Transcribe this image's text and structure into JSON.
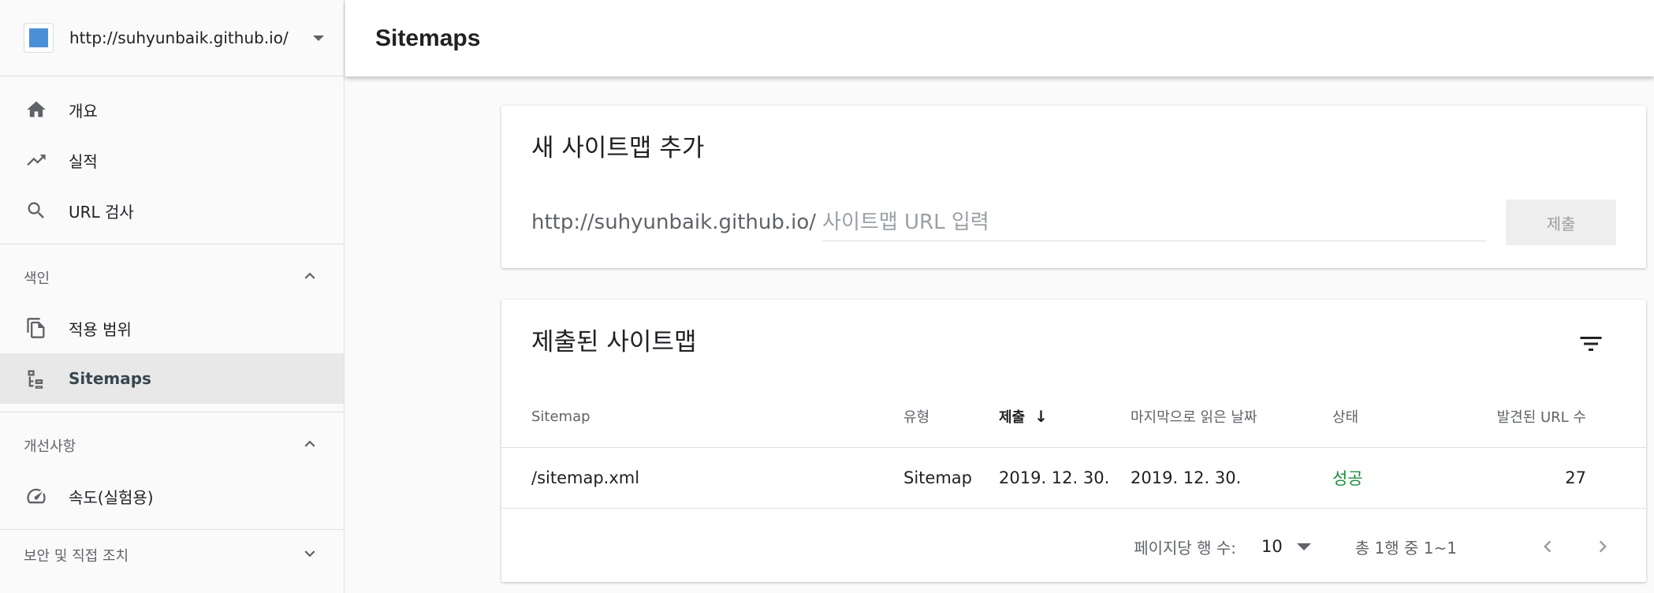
{
  "property": {
    "url": "http://suhyunbaik.github.io/",
    "icon": "blue-square-icon"
  },
  "sidebar": {
    "main_items": [
      {
        "label": "개요",
        "icon": "home-icon"
      },
      {
        "label": "실적",
        "icon": "trending-up-icon"
      },
      {
        "label": "URL 검사",
        "icon": "search-icon"
      }
    ],
    "index_section": {
      "title": "색인",
      "icon": "chevron-up-icon"
    },
    "index_items": [
      {
        "label": "적용 범위",
        "icon": "copy-pages-icon"
      },
      {
        "label": "Sitemaps",
        "icon": "sitemap-icon",
        "active": true
      }
    ],
    "enhance_section": {
      "title": "개선사항",
      "icon": "chevron-up-icon"
    },
    "enhance_items": [
      {
        "label": "속도(실험용)",
        "icon": "speedometer-icon"
      }
    ],
    "security_section": {
      "title": "보안 및 직접 조치",
      "icon": "chevron-down-icon"
    }
  },
  "header": {
    "title": "Sitemaps"
  },
  "add_card": {
    "title": "새 사이트맵 추가",
    "url_prefix": "http://suhyunbaik.github.io/",
    "placeholder": "사이트맵 URL 입력",
    "submit_label": "제출"
  },
  "submitted_card": {
    "title": "제출된 사이트맵",
    "columns": [
      "Sitemap",
      "유형",
      "제출",
      "마지막으로 읽은 날짜",
      "상태",
      "발견된 URL 수"
    ],
    "sort_arrow": "↓",
    "rows": [
      {
        "sitemap": "/sitemap.xml",
        "type": "Sitemap",
        "submitted": "2019. 12. 30.",
        "last_read": "2019. 12. 30.",
        "status": "성공",
        "urls": "27"
      }
    ],
    "pager": {
      "rows_label": "페이지당 행 수:",
      "rows_value": "10",
      "range": "총 1행 중 1~1"
    }
  },
  "colors": {
    "success": "#1e8e3e",
    "active_bg": "#e8e8e8",
    "property_square": "#4a90d9"
  }
}
